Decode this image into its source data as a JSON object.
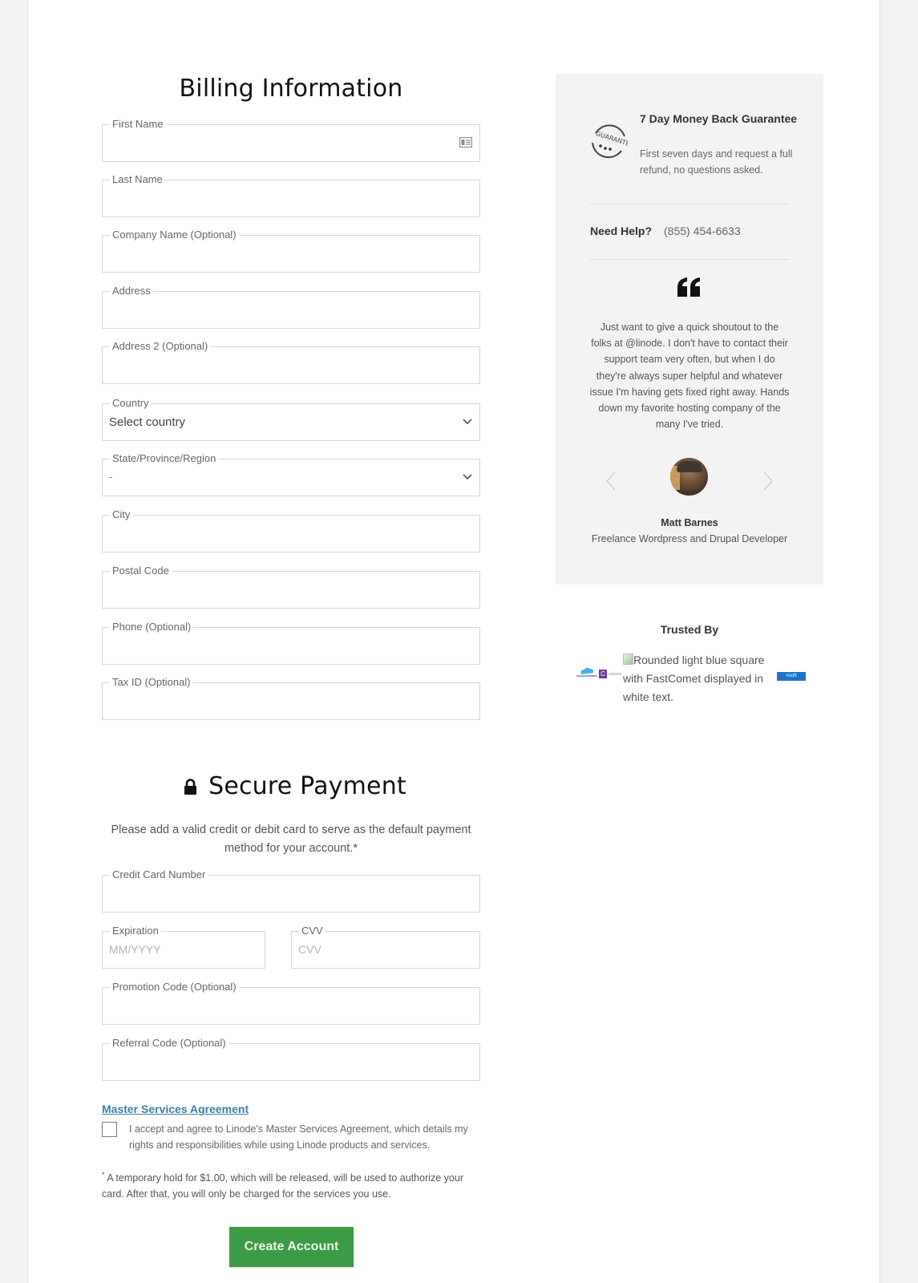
{
  "billing": {
    "title": "Billing Information",
    "fields": {
      "first_name": {
        "label": "First Name",
        "value": ""
      },
      "last_name": {
        "label": "Last Name",
        "value": ""
      },
      "company": {
        "label": "Company Name (Optional)",
        "value": ""
      },
      "address": {
        "label": "Address",
        "value": ""
      },
      "address2": {
        "label": "Address 2 (Optional)",
        "value": ""
      },
      "country": {
        "label": "Country",
        "value": "Select country"
      },
      "state": {
        "label": "State/Province/Region",
        "value": "-"
      },
      "city": {
        "label": "City",
        "value": ""
      },
      "postal": {
        "label": "Postal Code",
        "value": ""
      },
      "phone": {
        "label": "Phone (Optional)",
        "value": ""
      },
      "tax_id": {
        "label": "Tax ID (Optional)",
        "value": ""
      }
    }
  },
  "payment": {
    "title": "Secure Payment",
    "intro": "Please add a valid credit or debit card to serve as the default payment method for your account.*",
    "fields": {
      "card_number": {
        "label": "Credit Card Number",
        "value": ""
      },
      "expiration": {
        "label": "Expiration",
        "placeholder": "MM/YYYY"
      },
      "cvv": {
        "label": "CVV",
        "placeholder": "CVV"
      },
      "promo": {
        "label": "Promotion Code (Optional)",
        "value": ""
      },
      "referral": {
        "label": "Referral Code (Optional)",
        "value": ""
      }
    },
    "msa_link": "Master Services Agreement",
    "msa_checked": false,
    "msa_text": "I accept and agree to Linode's Master Services Agreement, which details my rights and responsibilities while using Linode products and services.",
    "note_mark": "*",
    "note": "A temporary hold for $1.00, which will be released, will be used to authorize your card. After that, you will only be charged for the services you use.",
    "submit_label": "Create Account",
    "submit_color": "#3d9b45"
  },
  "sidebar": {
    "guarantee": {
      "icon": "guarantee-stamp-icon",
      "title": "7 Day Money Back Guarantee",
      "text": "First seven days and request a full refund, no questions asked."
    },
    "help": {
      "label": "Need Help?",
      "phone": "(855) 454-6633"
    },
    "testimonial": {
      "icon": "quote-icon",
      "text": "Just want to give a quick shoutout to the folks at @linode. I don't have to contact their support team very often, but when I do they're always super helpful and whatever issue I'm having gets fixed right away. Hands down my favorite hosting company of the many I've tried.",
      "author": "Matt Barnes",
      "role": "Freelance Wordpress and Drupal Developer"
    },
    "trusted_by": {
      "title": "Trusted By",
      "broken_image_alt": "Rounded light blue square with FastComet displayed in white text.",
      "logo_c_letter": "C",
      "logo_blue_text": "nsoft"
    }
  }
}
